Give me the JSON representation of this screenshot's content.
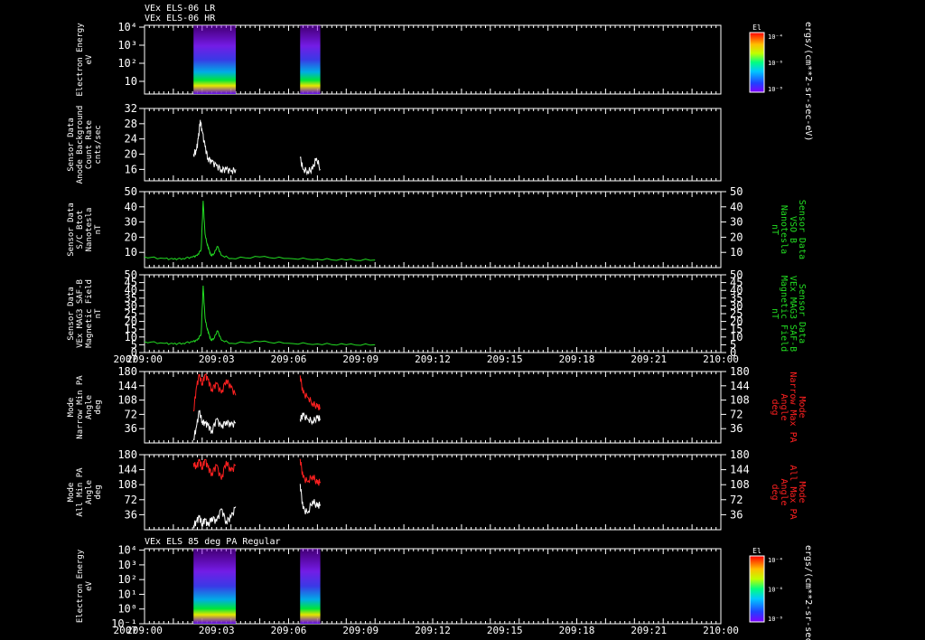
{
  "header": {
    "line1": "VEx ELS-06 LR",
    "line2": "VEx ELS-06 HR",
    "bottom_title": "VEx ELS 85 deg PA Regular"
  },
  "time_axis": {
    "year": "2007",
    "ticks": [
      "209:00",
      "209:03",
      "209:06",
      "209:09",
      "209:12",
      "209:15",
      "209:18",
      "209:21",
      "210:00"
    ]
  },
  "colors": {
    "white": "#ffffff",
    "green": "#22dd22",
    "red": "#ff2020",
    "frame": "#ffffff"
  },
  "chart_data": [
    {
      "type": "heatmap",
      "name": "panel1",
      "ylabel": [
        "Electron Energy",
        "eV"
      ],
      "y_ticks": [
        "10",
        "10²",
        "10³",
        "10⁴"
      ],
      "ylim_log": [
        0.3,
        4.1
      ],
      "colorbar": {
        "title": "El",
        "ticks": [
          "10⁻⁴",
          "10⁻⁶",
          "10⁻⁸"
        ],
        "unit": "ergs/(cm**2-sr-sec-eV)"
      },
      "data_intervals_min": [
        [
          5.1,
          9.5
        ],
        [
          16.2,
          18.3
        ]
      ]
    },
    {
      "type": "line",
      "name": "panel2",
      "ylabel": [
        "Sensor Data",
        "Anode Background",
        "Count Rate",
        "cnts/sec"
      ],
      "y_ticks": [
        "16",
        "20",
        "24",
        "28",
        "32"
      ],
      "ylim": [
        13,
        32
      ],
      "series": [
        {
          "color": "white",
          "points": [
            [
              5.1,
              20
            ],
            [
              5.4,
              21
            ],
            [
              5.6,
              24
            ],
            [
              5.8,
              29
            ],
            [
              6.0,
              26
            ],
            [
              6.3,
              22
            ],
            [
              6.6,
              19
            ],
            [
              7.0,
              18
            ],
            [
              7.5,
              17
            ],
            [
              8.0,
              16
            ],
            [
              8.5,
              16
            ],
            [
              9.0,
              15.5
            ],
            [
              9.5,
              16
            ],
            [
              16.2,
              19
            ],
            [
              16.5,
              16
            ],
            [
              17.0,
              15.5
            ],
            [
              17.5,
              16
            ],
            [
              17.9,
              19
            ],
            [
              18.3,
              16
            ]
          ]
        }
      ]
    },
    {
      "type": "line",
      "name": "panel3",
      "ylabel": [
        "Sensor Data",
        "S/C Btot",
        "Nanotesla",
        "nT"
      ],
      "y2label": [
        "Sensor Data",
        "VSO B",
        "Nanotesla",
        "nT"
      ],
      "y_ticks": [
        "10",
        "20",
        "30",
        "40",
        "50"
      ],
      "ylim": [
        0,
        50
      ],
      "series": [
        {
          "color": "green",
          "points": [
            [
              0,
              7
            ],
            [
              2,
              6
            ],
            [
              3,
              5.5
            ],
            [
              4,
              6
            ],
            [
              5,
              7
            ],
            [
              5.5,
              8
            ],
            [
              5.9,
              12
            ],
            [
              6.1,
              44
            ],
            [
              6.3,
              22
            ],
            [
              6.5,
              16
            ],
            [
              6.7,
              12
            ],
            [
              6.9,
              8
            ],
            [
              7.2,
              9
            ],
            [
              7.6,
              14
            ],
            [
              8.0,
              8
            ],
            [
              9,
              6
            ],
            [
              12,
              7
            ],
            [
              15,
              6
            ],
            [
              18,
              5.5
            ],
            [
              21,
              5
            ],
            [
              24,
              5
            ]
          ]
        }
      ]
    },
    {
      "type": "line",
      "name": "panel4",
      "ylabel": [
        "Sensor Data",
        "VEx MAG3 SAF-B",
        "Magnetic Field",
        "nT"
      ],
      "y2label": [
        "Sensor Data",
        "VEx MAG3 SAF-B",
        "Magnetic Field",
        "nT"
      ],
      "y_ticks": [
        "0",
        "5",
        "10",
        "15",
        "20",
        "25",
        "30",
        "35",
        "40",
        "45",
        "50"
      ],
      "ylim": [
        0,
        50
      ],
      "series": [
        {
          "color": "green",
          "points": [
            [
              0,
              7
            ],
            [
              2,
              6
            ],
            [
              3,
              5.5
            ],
            [
              4,
              6
            ],
            [
              5,
              7
            ],
            [
              5.5,
              8
            ],
            [
              5.9,
              12
            ],
            [
              6.1,
              43
            ],
            [
              6.3,
              22
            ],
            [
              6.5,
              16
            ],
            [
              6.7,
              12
            ],
            [
              6.9,
              8
            ],
            [
              7.2,
              9
            ],
            [
              7.6,
              14
            ],
            [
              8.0,
              8
            ],
            [
              9,
              6
            ],
            [
              12,
              7
            ],
            [
              15,
              6
            ],
            [
              18,
              5.5
            ],
            [
              21,
              5
            ],
            [
              24,
              5
            ]
          ]
        }
      ]
    },
    {
      "type": "line",
      "name": "panel5",
      "ylabel": [
        "Mode",
        "Narrow Min PA",
        "Angle",
        "deg"
      ],
      "y2label": [
        "Mode",
        "Narrow Max PA",
        "Angle",
        "deg"
      ],
      "y_ticks": [
        "36",
        "72",
        "108",
        "144",
        "180"
      ],
      "ylim": [
        0,
        180
      ],
      "series": [
        {
          "color": "red",
          "points": [
            [
              5.1,
              80
            ],
            [
              5.4,
              140
            ],
            [
              5.7,
              170
            ],
            [
              6.0,
              150
            ],
            [
              6.3,
              172
            ],
            [
              6.6,
              160
            ],
            [
              7.0,
              135
            ],
            [
              7.5,
              150
            ],
            [
              8.0,
              125
            ],
            [
              8.5,
              160
            ],
            [
              9.0,
              140
            ],
            [
              9.5,
              120
            ],
            [
              16.2,
              170
            ],
            [
              16.5,
              125
            ],
            [
              17.0,
              115
            ],
            [
              17.5,
              100
            ],
            [
              18.0,
              90
            ],
            [
              18.3,
              88
            ]
          ]
        },
        {
          "color": "white",
          "points": [
            [
              5.1,
              10
            ],
            [
              5.4,
              40
            ],
            [
              5.7,
              80
            ],
            [
              6.0,
              55
            ],
            [
              6.3,
              50
            ],
            [
              6.6,
              45
            ],
            [
              7.0,
              30
            ],
            [
              7.5,
              60
            ],
            [
              8.0,
              40
            ],
            [
              8.5,
              55
            ],
            [
              9.0,
              45
            ],
            [
              9.5,
              50
            ],
            [
              16.2,
              60
            ],
            [
              16.5,
              70
            ],
            [
              17.0,
              60
            ],
            [
              17.5,
              55
            ],
            [
              18.0,
              62
            ],
            [
              18.3,
              60
            ]
          ]
        }
      ]
    },
    {
      "type": "line",
      "name": "panel6",
      "ylabel": [
        "Mode",
        "All Min PA",
        "Angle",
        "deg"
      ],
      "y2label": [
        "Mode",
        "All Max PA",
        "Angle",
        "deg"
      ],
      "y_ticks": [
        "36",
        "72",
        "108",
        "144",
        "180"
      ],
      "ylim": [
        0,
        180
      ],
      "series": [
        {
          "color": "red",
          "points": [
            [
              5.1,
              160
            ],
            [
              5.4,
              150
            ],
            [
              5.7,
              165
            ],
            [
              6.0,
              150
            ],
            [
              6.3,
              168
            ],
            [
              6.6,
              150
            ],
            [
              7.0,
              135
            ],
            [
              7.5,
              155
            ],
            [
              8.0,
              120
            ],
            [
              8.5,
              165
            ],
            [
              9.0,
              140
            ],
            [
              9.5,
              155
            ],
            [
              16.2,
              170
            ],
            [
              16.5,
              125
            ],
            [
              17.0,
              115
            ],
            [
              17.5,
              130
            ],
            [
              18.0,
              110
            ],
            [
              18.3,
              115
            ]
          ]
        },
        {
          "color": "white",
          "points": [
            [
              5.1,
              10
            ],
            [
              5.4,
              20
            ],
            [
              5.7,
              30
            ],
            [
              6.0,
              15
            ],
            [
              6.3,
              25
            ],
            [
              6.6,
              10
            ],
            [
              7.0,
              30
            ],
            [
              7.5,
              20
            ],
            [
              8.0,
              50
            ],
            [
              8.5,
              20
            ],
            [
              9.0,
              30
            ],
            [
              9.5,
              55
            ],
            [
              16.2,
              110
            ],
            [
              16.5,
              50
            ],
            [
              17.0,
              40
            ],
            [
              17.5,
              70
            ],
            [
              18.0,
              55
            ],
            [
              18.3,
              60
            ]
          ]
        }
      ]
    },
    {
      "type": "heatmap",
      "name": "panel7",
      "ylabel": [
        "Electron Energy",
        "eV"
      ],
      "y_ticks": [
        "10⁻¹",
        "10⁰",
        "10¹",
        "10²",
        "10³",
        "10⁴"
      ],
      "ylim_log": [
        -1,
        4.1
      ],
      "colorbar": {
        "title": "El",
        "ticks": [
          "10⁻⁴",
          "10⁻⁶",
          "10⁻⁸"
        ],
        "unit": "ergs/(cm**2-sr-sec-eV)"
      },
      "data_intervals_min": [
        [
          5.1,
          9.5
        ],
        [
          16.2,
          18.3
        ]
      ]
    }
  ]
}
